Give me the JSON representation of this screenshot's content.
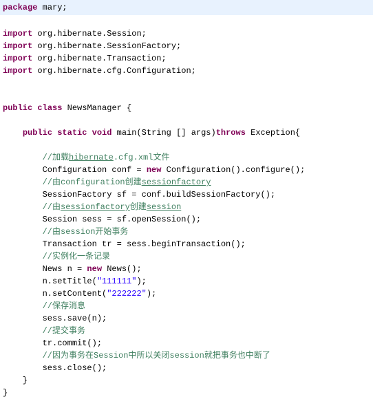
{
  "package_line": {
    "kw": "package",
    "name": " mary;"
  },
  "imports": [
    {
      "kw": "import",
      "path": " org.hibernate.Session;"
    },
    {
      "kw": "import",
      "path": " org.hibernate.SessionFactory;"
    },
    {
      "kw": "import",
      "path": " org.hibernate.Transaction;"
    },
    {
      "kw": "import",
      "path": " org.hibernate.cfg.Configuration;"
    }
  ],
  "class_decl": {
    "kw1": "public",
    "kw2": "class",
    "name": " NewsManager {"
  },
  "main_decl": {
    "kw1": "public",
    "kw2": "static",
    "kw3": "void",
    "sig1": " main(String [] args)",
    "kw4": "throws",
    "sig2": " Exception{"
  },
  "body": [
    {
      "type": "blank"
    },
    {
      "type": "comment_mixed",
      "pre": "//加载",
      "ul": "hibernate",
      "post": ".cfg.xml文件"
    },
    {
      "type": "code_new",
      "pre": "Configuration conf = ",
      "kw": "new",
      "post": " Configuration().configure();"
    },
    {
      "type": "comment_mixed",
      "pre": "//由configuration创建",
      "ul": "sessionfactory",
      "post": ""
    },
    {
      "type": "code_plain",
      "text": "SessionFactory sf = conf.buildSessionFactory();"
    },
    {
      "type": "comment_mixed2",
      "pre": "//由",
      "ul1": "sessionfactory",
      "mid": "创建",
      "ul2": "session",
      "post": ""
    },
    {
      "type": "code_plain",
      "text": "Session sess = sf.openSession();"
    },
    {
      "type": "comment_plain",
      "text": "//由session开始事务"
    },
    {
      "type": "code_plain",
      "text": "Transaction tr = sess.beginTransaction();"
    },
    {
      "type": "comment_plain",
      "text": "//实例化一条记录"
    },
    {
      "type": "code_new",
      "pre": "News n = ",
      "kw": "new",
      "post": " News();"
    },
    {
      "type": "code_string",
      "pre": "n.setTitle(",
      "str": "\"111111\"",
      "post": ");"
    },
    {
      "type": "code_string",
      "pre": "n.setContent(",
      "str": "\"222222\"",
      "post": ");"
    },
    {
      "type": "comment_plain",
      "text": "//保存消息"
    },
    {
      "type": "code_plain",
      "text": "sess.save(n);"
    },
    {
      "type": "comment_plain",
      "text": "//提交事务"
    },
    {
      "type": "code_plain",
      "text": "tr.commit();"
    },
    {
      "type": "comment_plain",
      "text": "//因为事务在Session中所以关闭session就把事务也中断了"
    },
    {
      "type": "code_plain",
      "text": "sess.close();"
    }
  ],
  "close_method": "    }",
  "close_class": "}"
}
